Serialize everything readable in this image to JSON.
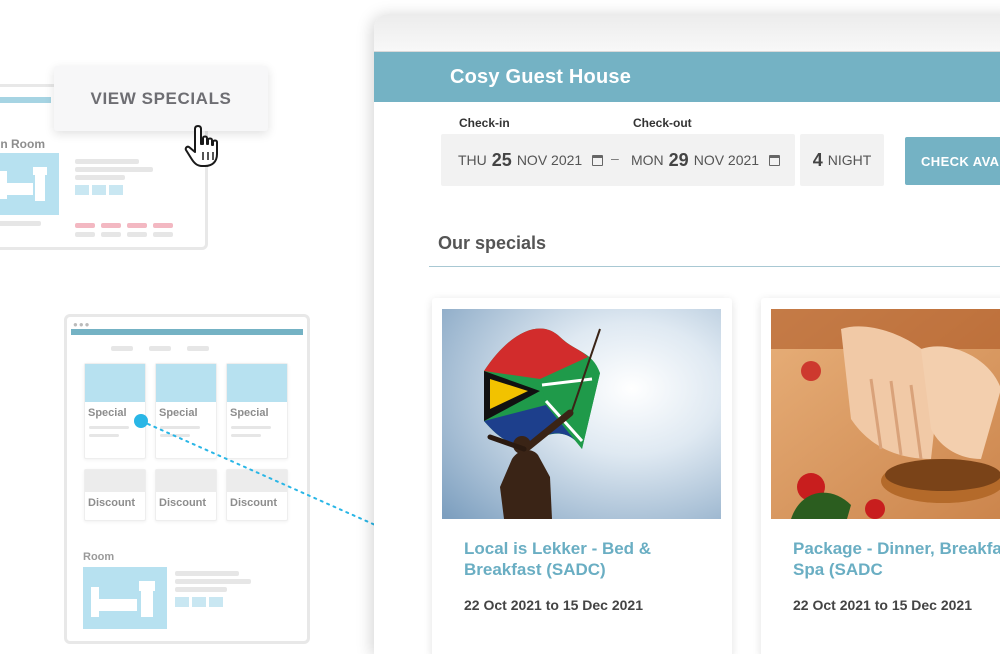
{
  "left_mockup": {
    "room_label": "in Room",
    "view_specials_label": "VIEW SPECIALS",
    "special_labels": [
      "Special",
      "Special",
      "Special"
    ],
    "discount_labels": [
      "Discount",
      "Discount",
      "Discount"
    ],
    "room_label_2": "Room"
  },
  "window": {
    "title": "Cosy Guest House",
    "checkin_label": "Check-in",
    "checkout_label": "Check-out",
    "checkin": {
      "weekday": "THU",
      "day": "25",
      "month_year": "NOV 2021"
    },
    "separator": "–",
    "checkout": {
      "weekday": "MON",
      "day": "29",
      "month_year": "NOV 2021"
    },
    "nights": {
      "count": "4",
      "label": "NIGHT"
    },
    "check_button": "CHECK AVA",
    "specials_heading": "Our specials",
    "cards": [
      {
        "title": "Local is Lekker - Bed & Breakfast (SADC)",
        "dates": "22 Oct 2021 to 15 Dec 2021"
      },
      {
        "title": "Package - Dinner, Breakfast & Spa (SADC",
        "dates": "22 Oct 2021 to 15 Dec 2021"
      }
    ]
  },
  "colors": {
    "brand_teal": "#74b2c4",
    "link_teal": "#6aaec3",
    "mockup_blue": "#b7e1f0",
    "connector_blue": "#29b6e6",
    "mockup_pink": "#f3b8c2"
  },
  "icons": [
    "hand-pointer-icon",
    "calendar-icon",
    "bed-icon",
    "image-icon"
  ]
}
